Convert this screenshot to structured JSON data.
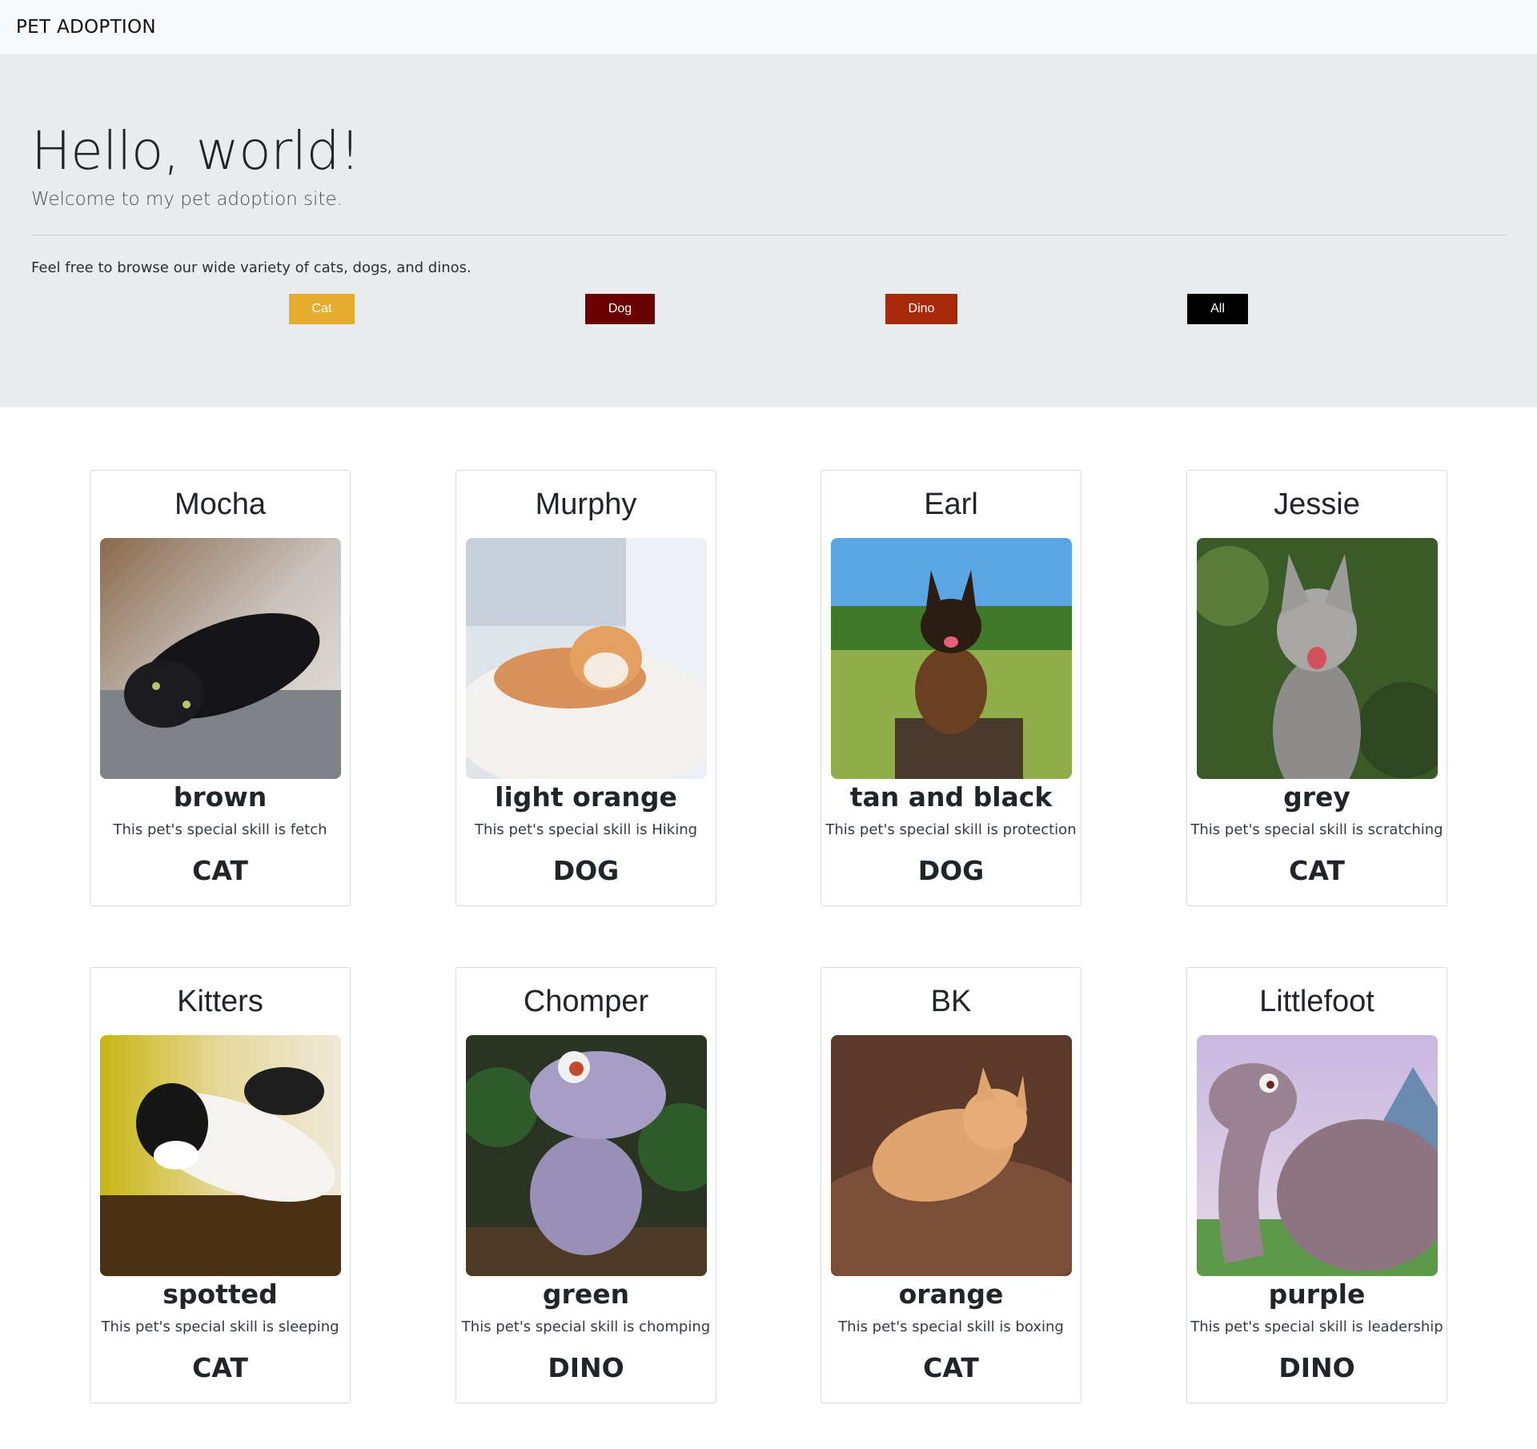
{
  "navbar": {
    "brand": "PET ADOPTION"
  },
  "hero": {
    "title": "Hello, world!",
    "lead": "Welcome to my pet adoption site.",
    "browse_text": "Feel free to browse our wide variety of cats, dogs, and dinos."
  },
  "filters": {
    "cat": {
      "label": "Cat",
      "color": "#e6ac2c"
    },
    "dog": {
      "label": "Dog",
      "color": "#6b0000"
    },
    "dino": {
      "label": "Dino",
      "color": "#a8290a"
    },
    "all": {
      "label": "All",
      "color": "#000000"
    }
  },
  "pets": [
    {
      "name": "Mocha",
      "color": "brown",
      "skill": "This pet's special skill is fetch",
      "type": "CAT"
    },
    {
      "name": "Murphy",
      "color": "light orange",
      "skill": "This pet's special skill is Hiking",
      "type": "DOG"
    },
    {
      "name": "Earl",
      "color": "tan and black",
      "skill": "This pet's special skill is protection",
      "type": "DOG"
    },
    {
      "name": "Jessie",
      "color": "grey",
      "skill": "This pet's special skill is scratching",
      "type": "CAT"
    },
    {
      "name": "Kitters",
      "color": "spotted",
      "skill": "This pet's special skill is sleeping",
      "type": "CAT"
    },
    {
      "name": "Chomper",
      "color": "green",
      "skill": "This pet's special skill is chomping",
      "type": "DINO"
    },
    {
      "name": "BK",
      "color": "orange",
      "skill": "This pet's special skill is boxing",
      "type": "CAT"
    },
    {
      "name": "Littlefoot",
      "color": "purple",
      "skill": "This pet's special skill is leadership",
      "type": "DINO"
    }
  ]
}
